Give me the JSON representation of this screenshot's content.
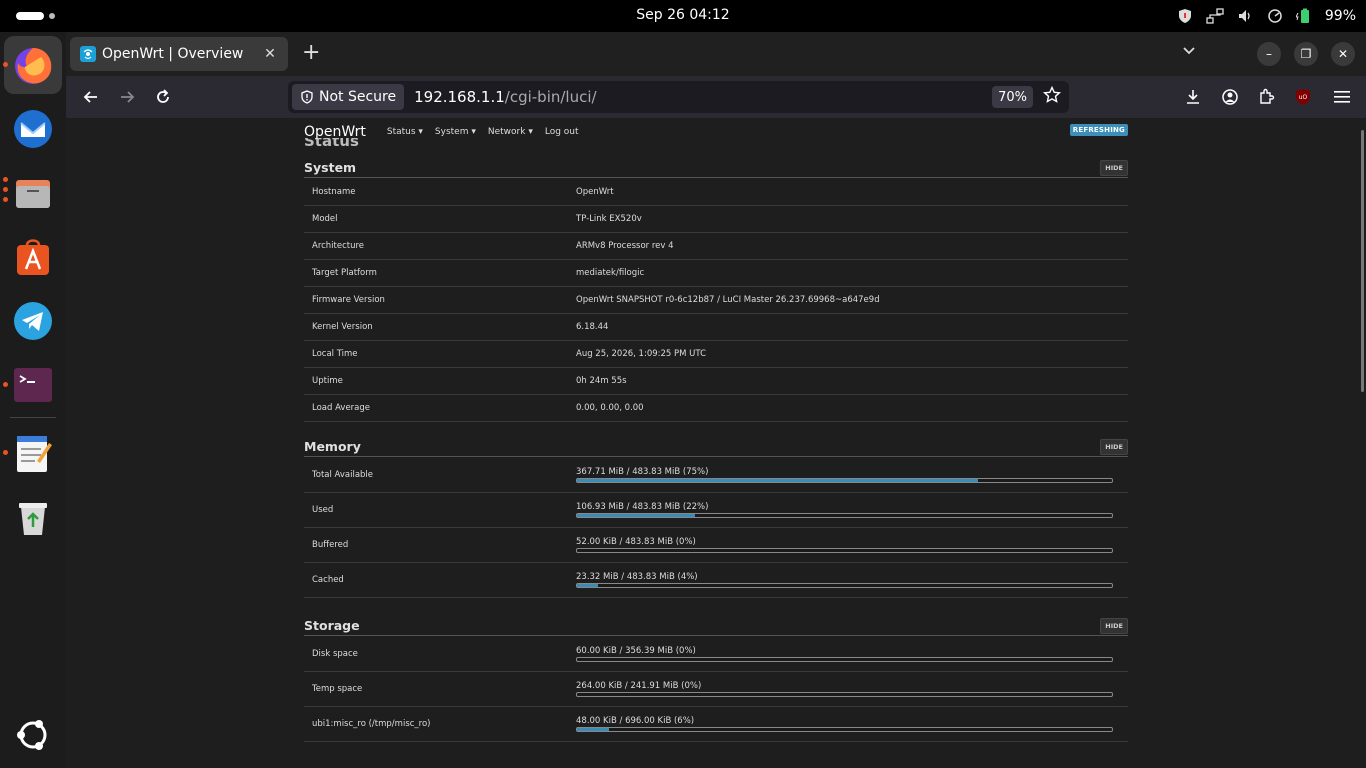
{
  "system_bar": {
    "clock": "Sep 26  04:12",
    "battery": "99%"
  },
  "browser": {
    "tab_title": "OpenWrt | Overview",
    "security_label": "Not Secure",
    "url_host": "192.168.1.1",
    "url_path": "/cgi-bin/luci/",
    "zoom": "70%"
  },
  "luci": {
    "brand": "OpenWrt",
    "menu": [
      "Status ▾",
      "System ▾",
      "Network ▾",
      "Log out"
    ],
    "refresh_badge": "REFRESHING",
    "page_heading": "Status",
    "hide_label": "HIDE",
    "system": {
      "title": "System",
      "rows": [
        {
          "k": "Hostname",
          "v": "OpenWrt"
        },
        {
          "k": "Model",
          "v": "TP-Link EX520v"
        },
        {
          "k": "Architecture",
          "v": "ARMv8 Processor rev 4"
        },
        {
          "k": "Target Platform",
          "v": "mediatek/filogic"
        },
        {
          "k": "Firmware Version",
          "v": "OpenWrt SNAPSHOT r0-6c12b87 / LuCI Master 26.237.69968~a647e9d"
        },
        {
          "k": "Kernel Version",
          "v": "6.18.44"
        },
        {
          "k": "Local Time",
          "v": "Aug 25, 2026, 1:09:25 PM UTC"
        },
        {
          "k": "Uptime",
          "v": "0h 24m 55s"
        },
        {
          "k": "Load Average",
          "v": "0.00, 0.00, 0.00"
        }
      ]
    },
    "memory": {
      "title": "Memory",
      "rows": [
        {
          "k": "Total Available",
          "v": "367.71 MiB / 483.83 MiB (75%)",
          "pct": 75
        },
        {
          "k": "Used",
          "v": "106.93 MiB / 483.83 MiB (22%)",
          "pct": 22
        },
        {
          "k": "Buffered",
          "v": "52.00 KiB / 483.83 MiB (0%)",
          "pct": 0
        },
        {
          "k": "Cached",
          "v": "23.32 MiB / 483.83 MiB (4%)",
          "pct": 4
        }
      ]
    },
    "storage": {
      "title": "Storage",
      "rows": [
        {
          "k": "Disk space",
          "v": "60.00 KiB / 356.39 MiB (0%)",
          "pct": 0
        },
        {
          "k": "Temp space",
          "v": "264.00 KiB / 241.91 MiB (0%)",
          "pct": 0
        },
        {
          "k": "ubi1:misc_ro (/tmp/misc_ro)",
          "v": "48.00 KiB / 696.00 KiB (6%)",
          "pct": 6
        }
      ]
    }
  }
}
